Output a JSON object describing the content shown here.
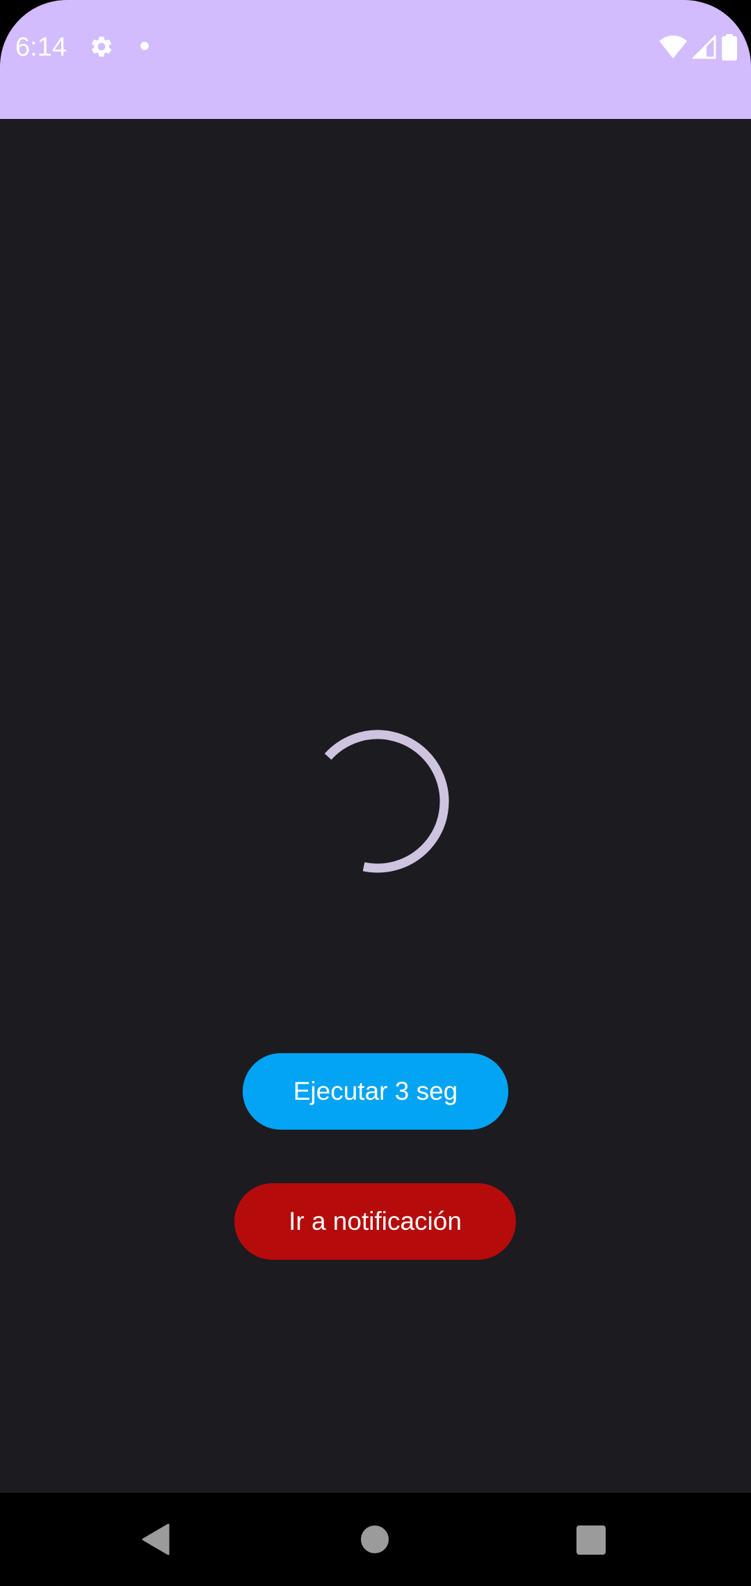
{
  "status_bar": {
    "time": "6:14",
    "background": "#d2bcfd",
    "icons": [
      "gear-icon",
      "notification-dot-icon",
      "wifi-icon",
      "cell-signal-icon",
      "battery-icon"
    ]
  },
  "main": {
    "background": "#1c1b20",
    "spinner": {
      "color": "#cfc4e0",
      "state": "loading"
    },
    "run_button": {
      "label": "Ejecutar 3 seg",
      "color": "#03a4f4"
    },
    "notify_button": {
      "label": "Ir a notificación",
      "color": "#b60b0b"
    }
  },
  "nav_bar": {
    "icons": [
      "back-icon",
      "home-icon",
      "recents-icon"
    ]
  }
}
